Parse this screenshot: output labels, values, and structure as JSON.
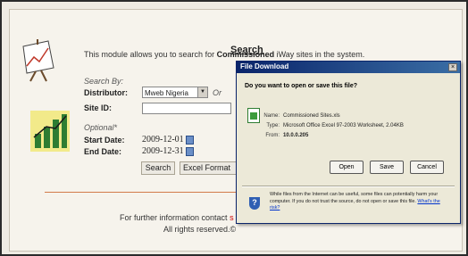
{
  "page": {
    "title": "Search",
    "intro_prefix": "This module allows you to search for ",
    "intro_bold": "Commissioned",
    "intro_suffix": " iWay sites in the system."
  },
  "form": {
    "search_by_label": "Search By:",
    "distributor_label": "Distributor:",
    "distributor_value": "Mweb Nigeria",
    "or_label": "Or",
    "site_id_label": "Site ID:",
    "site_id_value": "",
    "optional_label": "Optional*",
    "start_date_label": "Start Date:",
    "start_date_value": "2009-12-01",
    "end_date_label": "End Date:",
    "end_date_value": "2009-12-31",
    "search_button": "Search",
    "excel_button": "Excel Format"
  },
  "footer": {
    "line1_prefix": "For further information contact ",
    "line1_link_fragment": "s",
    "line2": "All rights reserved.©"
  },
  "dialog": {
    "title": "File Download",
    "close_glyph": "×",
    "question": "Do you want to open or save this file?",
    "name_label": "Name:",
    "name_value": "Commissioned Sites.xls",
    "type_label": "Type:",
    "type_value": "Microsoft Office Excel 97-2003 Worksheet, 2.04KB",
    "from_label": "From:",
    "from_value": "10.0.0.205",
    "open_button": "Open",
    "save_button": "Save",
    "cancel_button": "Cancel",
    "warning_text": "While files from the Internet can be useful, some files can potentially harm your computer. If you do not trust the source, do not open or save this file.",
    "warning_link": "What's the risk?"
  },
  "icons": {
    "easel": "chart-easel-icon",
    "bar_chart": "bar-chart-icon",
    "calendar": "calendar-icon",
    "file": "excel-file-icon",
    "shield": "security-shield-icon"
  }
}
